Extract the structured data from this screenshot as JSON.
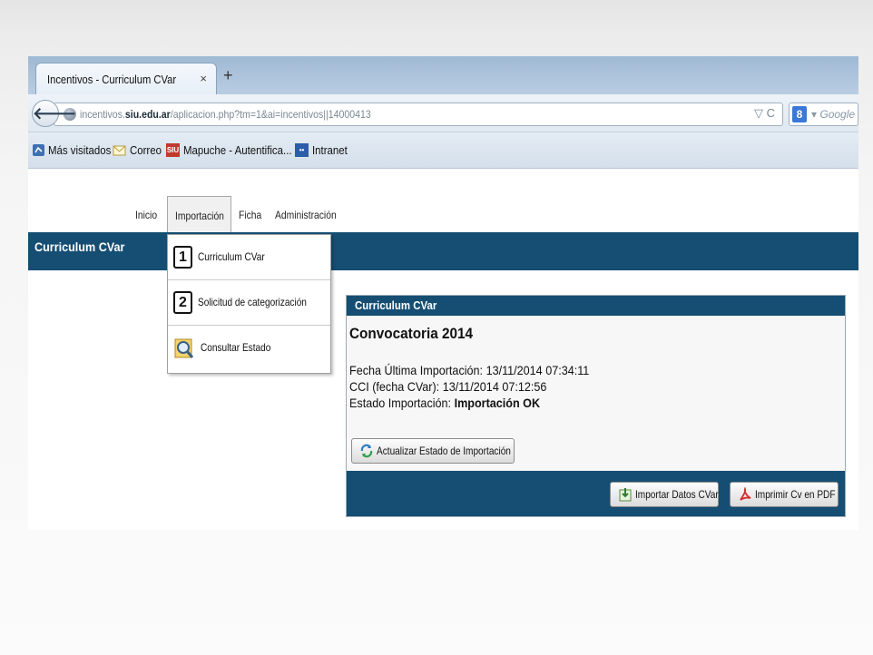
{
  "browser": {
    "tab_title": "Incentivos - Curriculum CVar",
    "tab_close": "×",
    "new_tab": "+",
    "url_prefix": "incentivos.",
    "url_domain": "siu.edu.ar",
    "url_rest": "/aplicacion.php?tm=1&ai=incentivos||14000413",
    "url_controls": "▽ C",
    "search_engine_badge": "8",
    "search_placeholder": "▾ Google",
    "bookmarks": [
      {
        "label": "Más visitados",
        "icon": "bookmark-icon"
      },
      {
        "label": "Correo",
        "icon": "mail-icon"
      },
      {
        "label": "Mapuche - Autentifica...",
        "icon": "siu-icon",
        "badge": "SIU"
      },
      {
        "label": "Intranet",
        "icon": "intranet-icon",
        "badge": "••"
      }
    ]
  },
  "app": {
    "menu": [
      "Inicio",
      "Importación",
      "Ficha",
      "Administración"
    ],
    "active_menu": "Importación",
    "header_title": "Curriculum CVar",
    "dropdown": [
      {
        "num": "1",
        "label": "Curriculum CVar"
      },
      {
        "num": "2",
        "label": "Solicitud de categorización"
      },
      {
        "num": "",
        "label": "Consultar Estado",
        "icon": "magnifier-icon"
      }
    ],
    "panel": {
      "title": "Curriculum CVar",
      "subtitle": "Convocatoria 2014",
      "fecha_label": "Fecha Última Importación:",
      "fecha_value": "13/11/2014 07:34:11",
      "cci_label": "CCI (fecha CVar):",
      "cci_value": "13/11/2014 07:12:56",
      "estado_label": "Estado Importación:",
      "estado_value": "Importación OK",
      "refresh_button": "Actualizar Estado de Importación",
      "import_button": "Importar Datos CVar",
      "print_button": "Imprimir Cv en PDF"
    }
  },
  "colors": {
    "header_blue": "#164e73",
    "background": "#f5f5f5"
  }
}
